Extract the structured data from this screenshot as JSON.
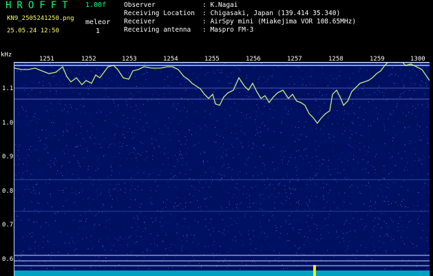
{
  "header": {
    "brand": "HROFFT",
    "version": "1.00f",
    "filename": "KN9_2505241250.png",
    "datetime": "25.05.24 12:50",
    "meleor_label": "meleor",
    "meleor_count": "1"
  },
  "info": {
    "observer_label": "Observer",
    "observer_value": ": K.Nagai",
    "location_label": "Receiving Location",
    "location_value": ": Chigasaki, Japan (139.414 35.340)",
    "receiver_label": "Receiver",
    "receiver_value": ": AirSpy mini (Miakejima VOR 108.65MHz)",
    "antenna_label": "Receiving antenna",
    "antenna_value": ": Maspro FM-3"
  },
  "axis": {
    "y_unit": "kHz",
    "y_ticks": [
      "1.1",
      "1.0",
      "0.9",
      "0.8",
      "0.7",
      "0.6"
    ],
    "x_ticks": [
      "1251",
      "1252",
      "1253",
      "1254",
      "1255",
      "1256",
      "1257",
      "1258",
      "1259",
      "1300"
    ]
  },
  "colors": {
    "background": "#000000",
    "plot_bg": "#001060",
    "trace": "#c8f080",
    "brand": "#00ff7f",
    "meta": "#ffff66"
  }
}
